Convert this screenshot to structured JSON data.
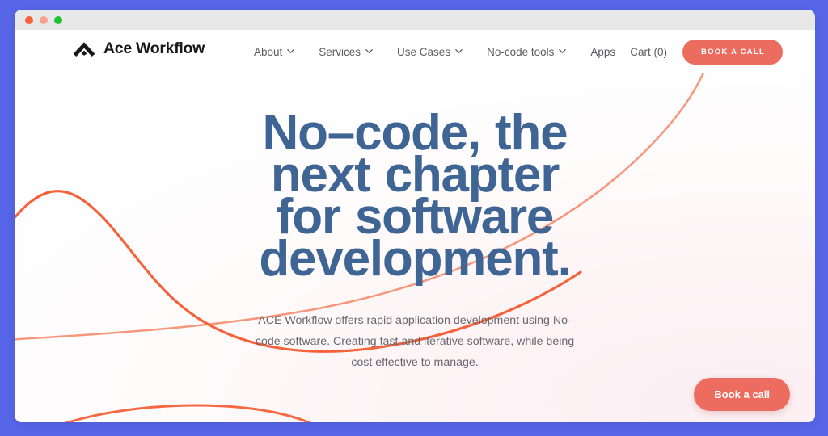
{
  "window": {
    "controls": [
      {
        "name": "close",
        "color": "#f8603e"
      },
      {
        "name": "minimize",
        "color": "#f5a293"
      },
      {
        "name": "maximize",
        "color": "#21c231"
      }
    ]
  },
  "theme": {
    "page_backdrop": "#5766e8",
    "titlebar": "#e8e8e8",
    "accent_coral": "#ec6d5f",
    "curve_orange": "#f4592e",
    "heading_blue": "#3f6595",
    "body_text": "#67676d",
    "nav_text": "#5c5c63",
    "page_bg": "#fdf4f6"
  },
  "brand": {
    "name": "Ace Workflow",
    "logo_icon": "ace-chevron-logo"
  },
  "nav": {
    "links": [
      {
        "label": "About",
        "has_dropdown": true
      },
      {
        "label": "Services",
        "has_dropdown": true
      },
      {
        "label": "Use Cases",
        "has_dropdown": true
      },
      {
        "label": "No-code tools",
        "has_dropdown": true
      },
      {
        "label": "Apps",
        "has_dropdown": false
      }
    ],
    "cart_label": "Cart (0)",
    "cta_label": "BOOK A CALL"
  },
  "hero": {
    "heading_lines": [
      "No–code, the",
      "next chapter",
      "for software",
      "development."
    ],
    "subtext": "ACE Workflow offers rapid application development using No-code software. Creating fast and iterative software, while being cost effective to manage."
  },
  "floating_cta": {
    "label": "Book a call"
  }
}
